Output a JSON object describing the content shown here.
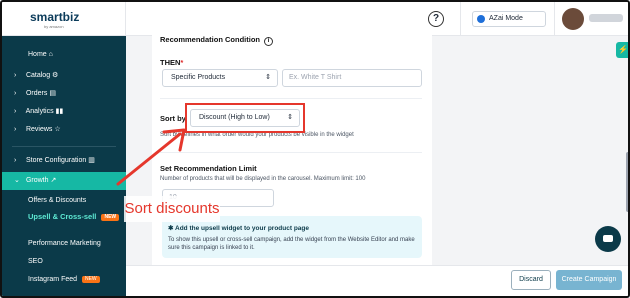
{
  "brand": {
    "logo": "smartbiz",
    "logo_sub": "by amazon"
  },
  "topbar": {
    "help_icon": "?",
    "mode_label": "AZai Mode"
  },
  "sidebar": {
    "items": [
      {
        "label": "Home",
        "icon": "home-icon",
        "glyph": "⌂"
      },
      {
        "label": "Catalog",
        "icon": "catalog-icon",
        "glyph": "⚙"
      },
      {
        "label": "Orders",
        "icon": "orders-icon",
        "glyph": "▤"
      },
      {
        "label": "Analytics",
        "icon": "analytics-icon",
        "glyph": "▮▮"
      },
      {
        "label": "Reviews",
        "icon": "star-icon",
        "glyph": "☆"
      },
      {
        "label": "Store Configuration",
        "icon": "store-icon",
        "glyph": "▥"
      },
      {
        "label": "Growth",
        "icon": "growth-icon",
        "glyph": "↗"
      },
      {
        "label": "Offers & Discounts"
      },
      {
        "label": "Upsell & Cross-sell",
        "badge": "NEW"
      },
      {
        "label": "Performance Marketing"
      },
      {
        "label": "SEO"
      },
      {
        "label": "Instagram Feed",
        "badge": "NEW"
      }
    ]
  },
  "form": {
    "condition_title": "Recommendation Condition",
    "then_label": "THEN",
    "required_mark": "*",
    "then_select": "Specific Products",
    "then_input_placeholder": "Ex. White T Shirt",
    "sort_label": "Sort by",
    "sort_value": "Discount (High to Low)",
    "sort_hint": "Sort by defines in what order would your products be visible in the widget",
    "limit_title": "Set Recommendation Limit",
    "limit_hint": "Number of products that will be displayed in the carousel. Maximum limit: 100",
    "limit_value": "10",
    "info_title": "Add the upsell widget to your product page",
    "info_desc": "To show this upsell or cross-sell campaign, add the widget from the Website Editor and make sure this campaign is linked to it."
  },
  "annotation": {
    "caption": "Sort discounts",
    "color": "#e5372c"
  },
  "footer": {
    "discard": "Discard",
    "create": "Create Campaign"
  },
  "colors": {
    "sidebar": "#0b3a49",
    "accent": "#16b8a4",
    "primary_button": "#78b4d1"
  }
}
